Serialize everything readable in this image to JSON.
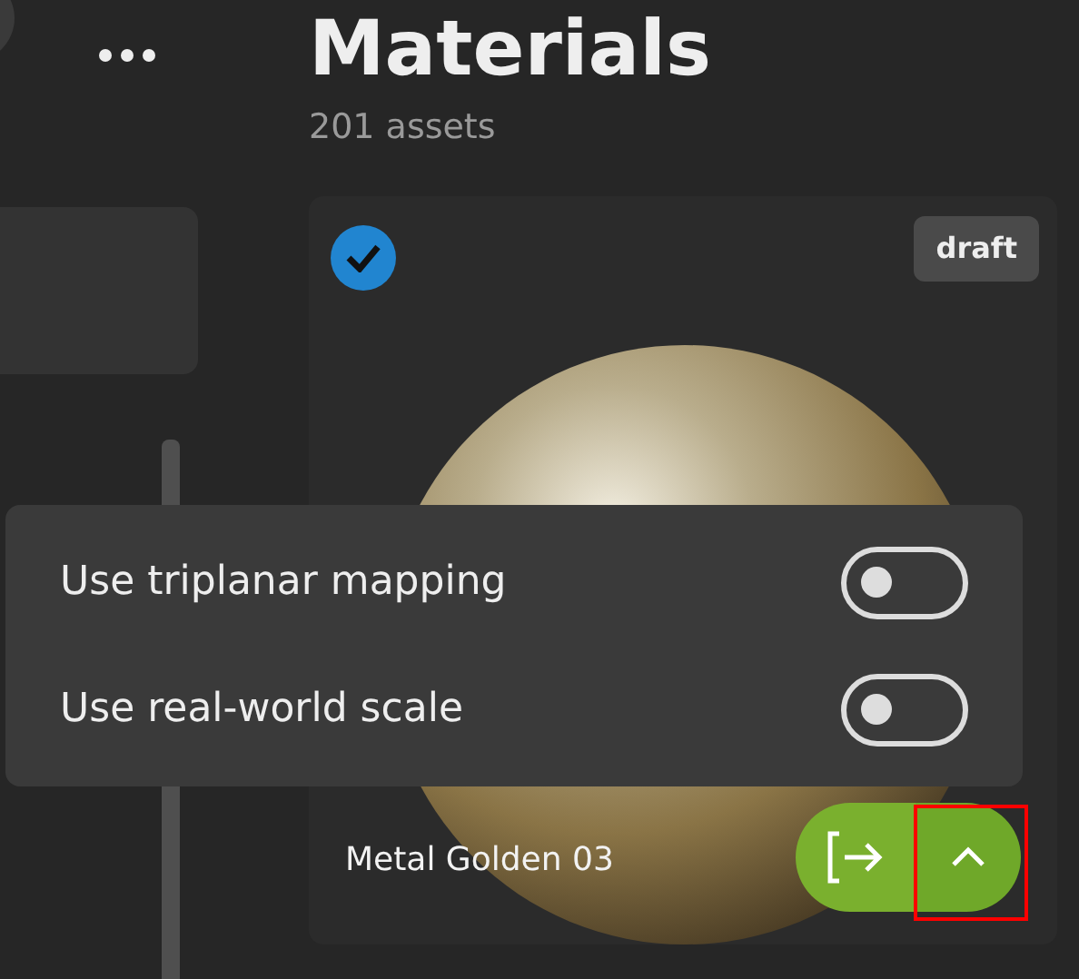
{
  "header": {
    "title": "Materials",
    "subtitle": "201 assets"
  },
  "card": {
    "name": "Metal Golden 03",
    "selected": true,
    "badge": "draft"
  },
  "options": [
    {
      "label": "Use triplanar mapping",
      "on": false
    },
    {
      "label": "Use real-world scale",
      "on": false
    }
  ]
}
